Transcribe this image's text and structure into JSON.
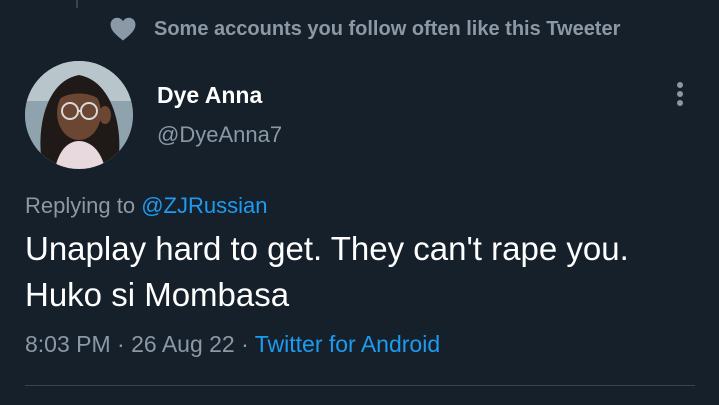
{
  "social_context": {
    "icon": "heart-icon",
    "text": "Some accounts you follow often like this Tweeter"
  },
  "author": {
    "display_name": "Dye Anna",
    "handle": "@DyeAnna7",
    "avatar": "avatar-photo"
  },
  "more_icon": "more-vertical-icon",
  "reply": {
    "prefix": "Replying to ",
    "handle": "@ZJRussian"
  },
  "tweet": {
    "text": "Unaplay hard to get. They can't rape you. Huko si Mombasa"
  },
  "meta": {
    "time": "8:03 PM",
    "separator": " · ",
    "date": "26 Aug 22",
    "separator2": " · ",
    "source": "Twitter for Android"
  },
  "colors": {
    "background": "#15202b",
    "primary_text": "#ffffff",
    "secondary_text": "#8b98a5",
    "link": "#1d9bf0",
    "divider": "#38444d"
  }
}
